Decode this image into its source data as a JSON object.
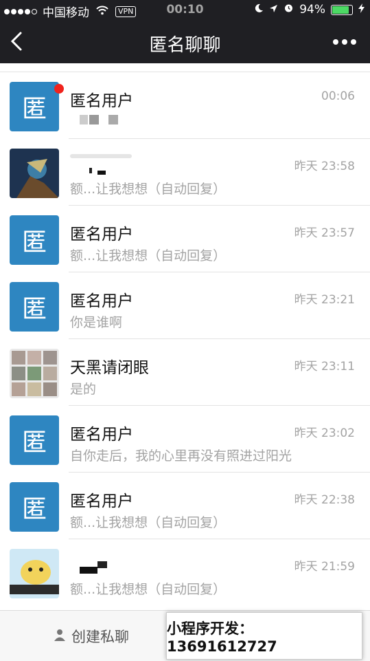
{
  "status": {
    "carrier": "中国移动",
    "vpn": "VPN",
    "time": "00:10",
    "battery": "94%",
    "battery_level": 0.94
  },
  "nav": {
    "title": "匿名聊聊"
  },
  "avatar_char": "匿",
  "conversations": [
    {
      "name": "匿名用户",
      "time": "00:06",
      "message": "",
      "unread": true
    },
    {
      "name": "",
      "time": "昨天 23:58",
      "message": "额...让我想想（自动回复）"
    },
    {
      "name": "匿名用户",
      "time": "昨天 23:57",
      "message": "额...让我想想（自动回复）"
    },
    {
      "name": "匿名用户",
      "time": "昨天 23:21",
      "message": "你是谁啊"
    },
    {
      "name": "天黑请闭眼",
      "time": "昨天 23:11",
      "message": "是的"
    },
    {
      "name": "匿名用户",
      "time": "昨天 23:02",
      "message": "自你走后，我的心里再没有照进过阳光"
    },
    {
      "name": "匿名用户",
      "time": "昨天 22:38",
      "message": "额...让我想想（自动回复）"
    },
    {
      "name": "",
      "time": "昨天 21:59",
      "message": "额...让我想想（自动回复）"
    }
  ],
  "bottom": {
    "create_label": "创建私聊"
  },
  "overlay": {
    "text": "小程序开发：13691612727"
  }
}
